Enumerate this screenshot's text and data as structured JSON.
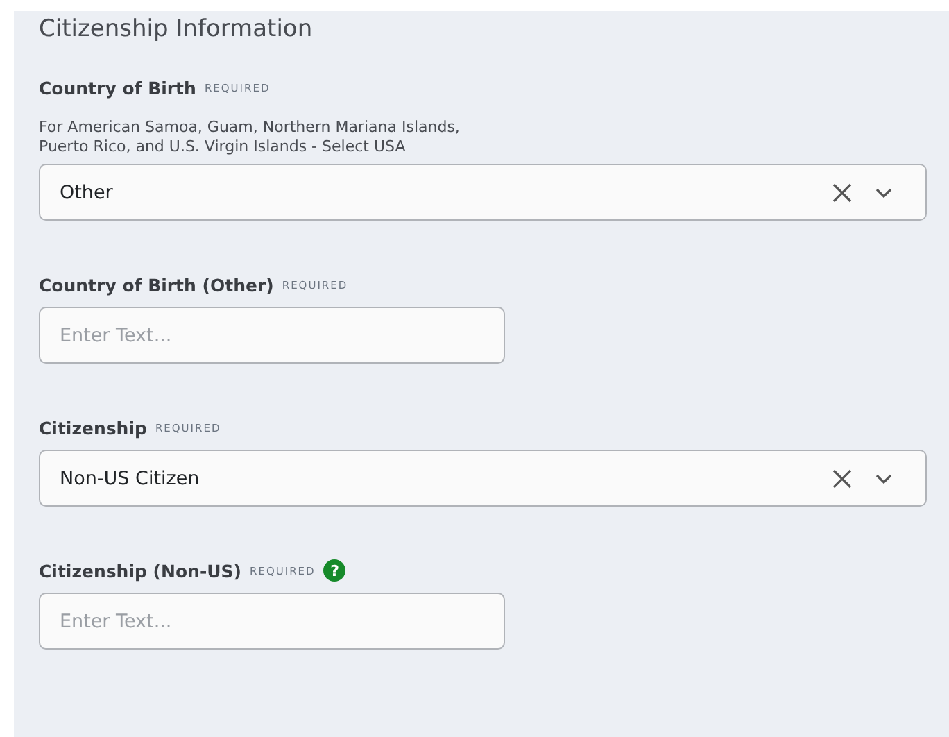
{
  "section": {
    "title": "Citizenship Information"
  },
  "fields": [
    {
      "kind": "select",
      "label": "Country of Birth",
      "required": "REQUIRED",
      "hint": "For American Samoa, Guam, Northern Mariana Islands,\nPuerto Rico, and U.S. Virgin Islands - Select USA",
      "value": "Other"
    },
    {
      "kind": "text",
      "label": "Country of Birth (Other)",
      "required": "REQUIRED",
      "placeholder": "Enter Text..."
    },
    {
      "kind": "select",
      "label": "Citizenship",
      "required": "REQUIRED",
      "value": "Non-US Citizen"
    },
    {
      "kind": "text",
      "label": "Citizenship (Non-US)",
      "required": "REQUIRED",
      "help_icon": "?",
      "placeholder": "Enter Text..."
    }
  ]
}
